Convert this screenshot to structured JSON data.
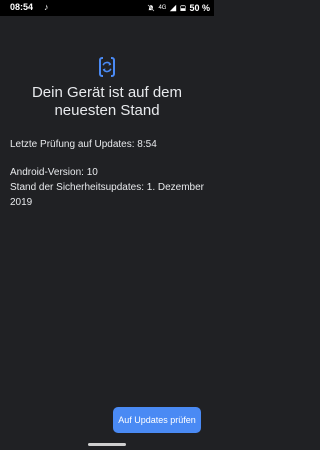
{
  "status_bar": {
    "time": "08:54",
    "notification_icon": "music-note-icon",
    "network_label": "4G",
    "battery_percent": "50 %",
    "icons": [
      "mute-icon",
      "signal-icon",
      "battery-icon"
    ]
  },
  "screen": {
    "icon": "system-update-icon",
    "accent_color": "#4a8af4",
    "headline": "Dein Gerät ist auf dem neuesten Stand",
    "last_check": "Letzte Prüfung auf Updates: 8:54",
    "android_version": "Android-Version: 10",
    "security_patch": "Stand der Sicherheitsupdates: 1. Dezember 2019"
  },
  "actions": {
    "check_updates_label": "Auf Updates prüfen"
  }
}
